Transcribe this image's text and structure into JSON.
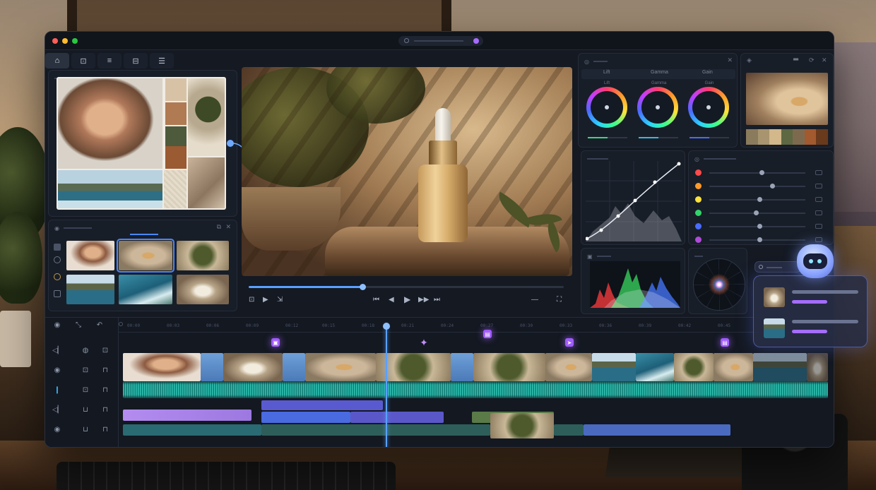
{
  "window": {
    "traffic_lights": [
      "#ff5f57",
      "#febc2e",
      "#28c840"
    ],
    "accent": "#5aa0ff",
    "marker_color": "#a05cff"
  },
  "tabs": [
    {
      "icon": "home-icon",
      "glyph": "⌂"
    },
    {
      "icon": "import-icon",
      "glyph": "⊡"
    },
    {
      "icon": "list-icon",
      "glyph": "≡"
    },
    {
      "icon": "folder-icon",
      "glyph": "⊟"
    },
    {
      "icon": "menu-icon",
      "glyph": "☰"
    }
  ],
  "viewer": {
    "playback_progress": 0.36,
    "controls": [
      "⊡",
      "▶",
      "⇲",
      "⏮",
      "◀",
      "▶",
      "▶▶",
      "⏭",
      "—",
      "⛶"
    ]
  },
  "color_panel": {
    "tabs": [
      "Lift",
      "Gamma",
      "Gain"
    ],
    "wheel_labels": [
      "Lift",
      "Gamma",
      "Gain"
    ],
    "swatches": [
      "#8b7b5d",
      "#a8956f",
      "#d2b88a",
      "#5e6842",
      "#7d6a4e",
      "#a25a2e",
      "#6a3a1c"
    ],
    "hsl_colors": [
      "#ff4a4a",
      "#ff9a2a",
      "#ffe23a",
      "#32d46a",
      "#4a6bff",
      "#b04ad8"
    ],
    "hsl_levels": [
      0.52,
      0.63,
      0.5,
      0.46,
      0.5,
      0.5
    ]
  },
  "moodboard": {
    "swatches": [
      "#d8c2a6",
      "#b07a52",
      "#4e5a3c",
      "#9a5a32"
    ]
  },
  "timeline": {
    "ruler": [
      "00:00",
      "00:03",
      "00:06",
      "00:09",
      "00:12",
      "00:15",
      "00:18",
      "00:21",
      "00:24",
      "00:27",
      "00:30",
      "00:33",
      "00:36",
      "00:39",
      "00:42",
      "00:45"
    ],
    "markers": [
      {
        "icon": "comment-marker-icon",
        "glyph": "▣"
      },
      {
        "icon": "sparkle-marker-icon",
        "glyph": "✦"
      },
      {
        "icon": "chat-marker-icon",
        "glyph": "▤"
      },
      {
        "icon": "send-marker-icon",
        "glyph": "➤"
      },
      {
        "icon": "chat-marker-icon",
        "glyph": "▤"
      }
    ]
  },
  "assistant": {
    "status": "active"
  }
}
